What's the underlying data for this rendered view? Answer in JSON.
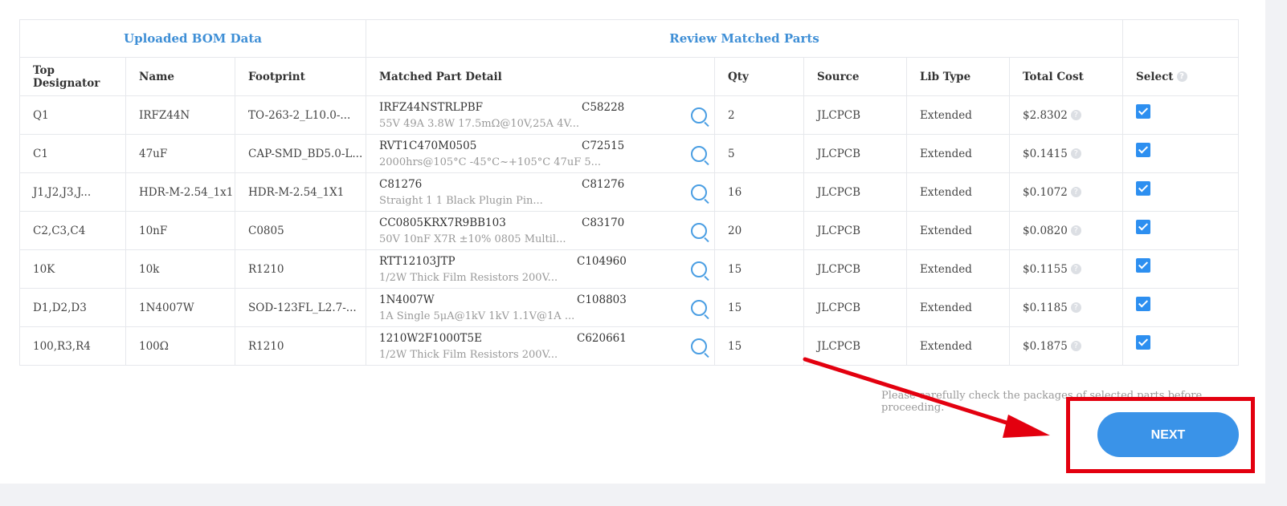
{
  "groups": {
    "uploaded": "Uploaded BOM Data",
    "review": "Review Matched Parts"
  },
  "columns": {
    "designator": "Top Designator",
    "name": "Name",
    "footprint": "Footprint",
    "detail": "Matched Part Detail",
    "qty": "Qty",
    "source": "Source",
    "lib_type": "Lib Type",
    "total_cost": "Total Cost",
    "select": "Select"
  },
  "rows": [
    {
      "designator": "Q1",
      "name": "IRFZ44N",
      "footprint": "TO-263-2_L10.0-...",
      "part": "IRFZ44NSTRLPBF",
      "code": "C58228",
      "desc": "55V 49A 3.8W 17.5mΩ@10V,25A 4V...",
      "qty": "2",
      "source": "JLCPCB",
      "lib_type": "Extended",
      "cost": "$2.8302",
      "selected": true
    },
    {
      "designator": "C1",
      "name": "47uF",
      "footprint": "CAP-SMD_BD5.0-L...",
      "part": "RVT1C470M0505",
      "code": "C72515",
      "desc": "2000hrs@105°C -45°C~+105°C 47uF 5...",
      "qty": "5",
      "source": "JLCPCB",
      "lib_type": "Extended",
      "cost": "$0.1415",
      "selected": true
    },
    {
      "designator": "J1,J2,J3,J...",
      "name": "HDR-M-2.54_1x1",
      "footprint": "HDR-M-2.54_1X1",
      "part": "C81276",
      "code": "C81276",
      "desc": "Straight 1 1 Black Plugin Pin...",
      "qty": "16",
      "source": "JLCPCB",
      "lib_type": "Extended",
      "cost": "$0.1072",
      "selected": true
    },
    {
      "designator": "C2,C3,C4",
      "name": "10nF",
      "footprint": "C0805",
      "part": "CC0805KRX7R9BB103",
      "code": "C83170",
      "desc": "50V 10nF X7R ±10% 0805 Multil...",
      "qty": "20",
      "source": "JLCPCB",
      "lib_type": "Extended",
      "cost": "$0.0820",
      "selected": true
    },
    {
      "designator": "10K",
      "name": "10k",
      "footprint": "R1210",
      "part": "RTT12103JTP",
      "code": "C104960",
      "desc": "1/2W Thick Film Resistors 200V...",
      "qty": "15",
      "source": "JLCPCB",
      "lib_type": "Extended",
      "cost": "$0.1155",
      "selected": true
    },
    {
      "designator": "D1,D2,D3",
      "name": "1N4007W",
      "footprint": "SOD-123FL_L2.7-...",
      "part": "1N4007W",
      "code": "C108803",
      "desc": "1A Single 5μA@1kV 1kV 1.1V@1A ...",
      "qty": "15",
      "source": "JLCPCB",
      "lib_type": "Extended",
      "cost": "$0.1185",
      "selected": true
    },
    {
      "designator": "100,R3,R4",
      "name": "100Ω",
      "footprint": "R1210",
      "part": "1210W2F1000T5E",
      "code": "C620661",
      "desc": "1/2W Thick Film Resistors 200V...",
      "qty": "15",
      "source": "JLCPCB",
      "lib_type": "Extended",
      "cost": "$0.1875",
      "selected": true
    }
  ],
  "note": "Please carefully check the packages of selected parts before proceeding.",
  "next_label": "NEXT",
  "colors": {
    "accent": "#3a93e8",
    "highlight": "#e3000f"
  }
}
